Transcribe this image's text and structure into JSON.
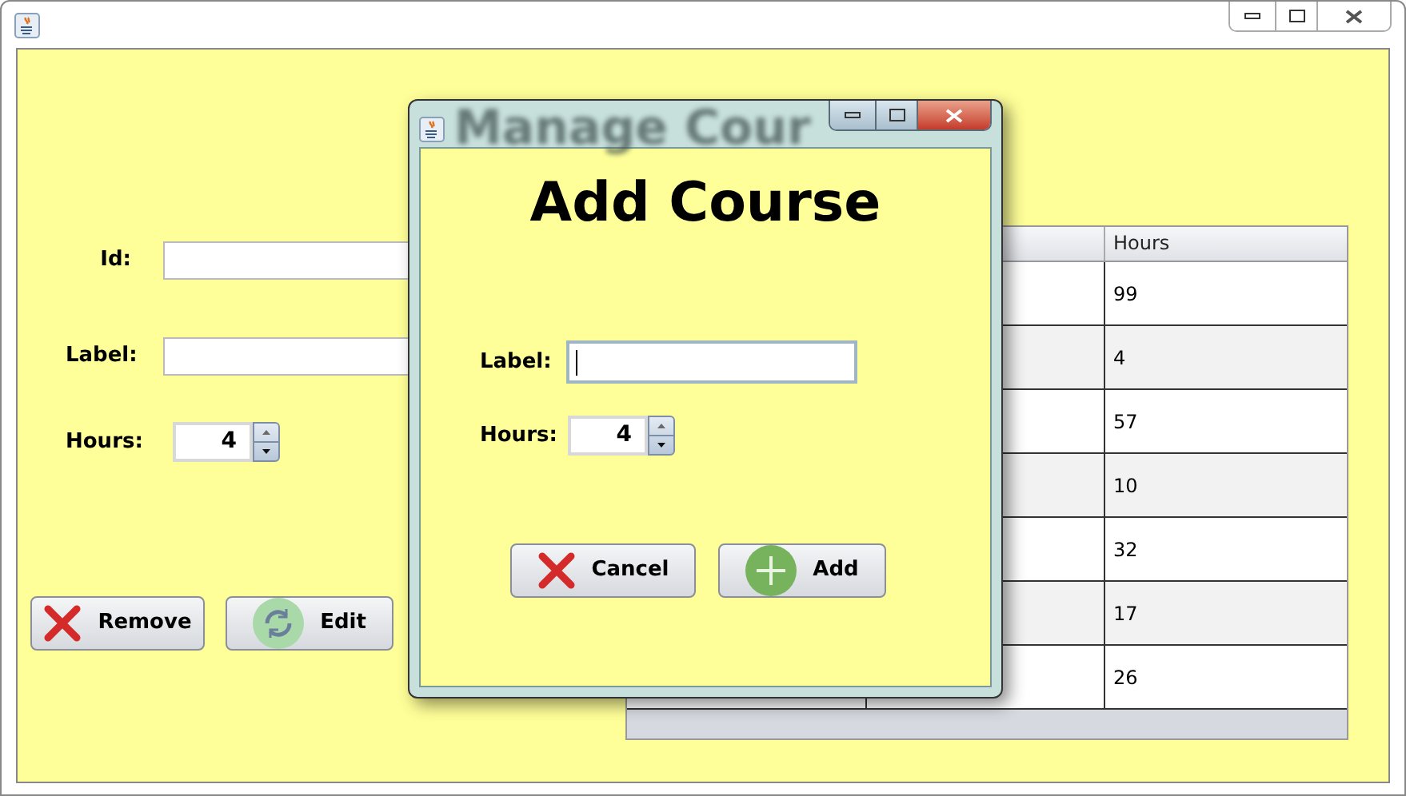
{
  "main_window": {
    "heading": "Manage Cour",
    "fields": [
      {
        "kind": "text",
        "label": "Id:"
      },
      {
        "kind": "text",
        "label": "Label:"
      },
      {
        "kind": "spinner",
        "label": "Hours:",
        "value": "4"
      }
    ],
    "buttons": [
      {
        "kind": "remove",
        "label": "Remove"
      },
      {
        "kind": "edit",
        "label": "Edit"
      }
    ],
    "table": {
      "columns": [
        {
          "title": "Hours"
        }
      ],
      "rows": [
        {
          "hours": "99"
        },
        {
          "hours": "4"
        },
        {
          "hours": "57"
        },
        {
          "hours": "10"
        },
        {
          "hours": "32"
        },
        {
          "hours": "17"
        },
        {
          "hours": "26"
        }
      ]
    }
  },
  "dialog": {
    "title": "Add Course",
    "fields": [
      {
        "kind": "text",
        "label": "Label:",
        "focused": true
      },
      {
        "kind": "spinner",
        "label": "Hours:",
        "value": "4"
      }
    ],
    "buttons": [
      {
        "kind": "cancel",
        "label": "Cancel"
      },
      {
        "kind": "add",
        "label": "Add"
      }
    ]
  }
}
